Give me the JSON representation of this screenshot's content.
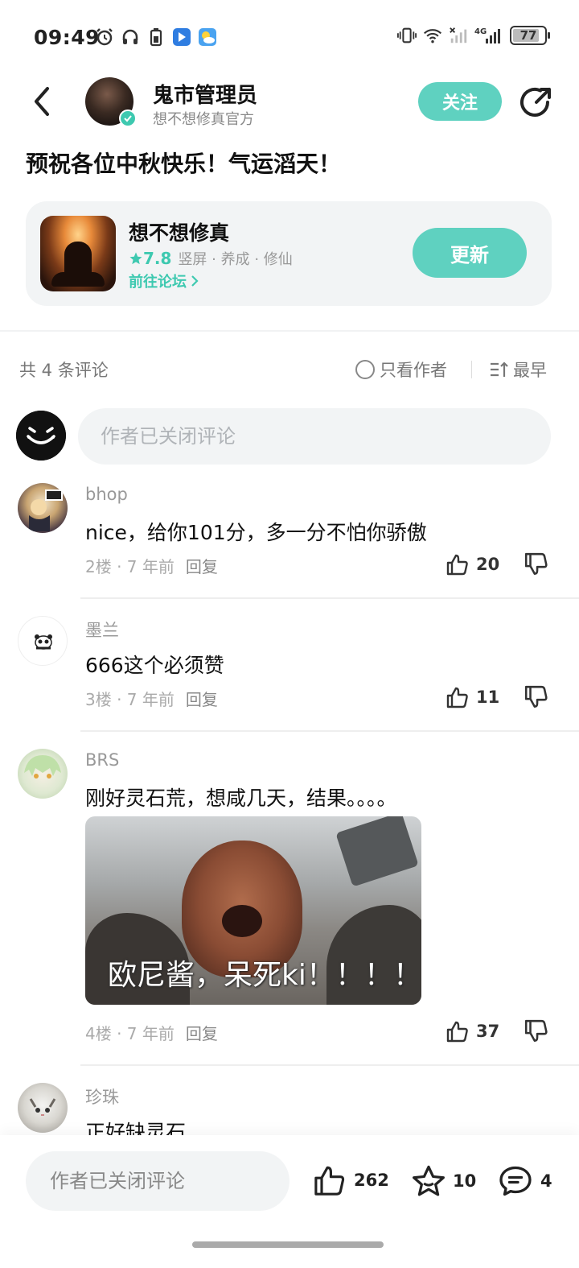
{
  "status_bar": {
    "time": "09:49",
    "battery": "77",
    "battery_level": 0.77,
    "network": "4G"
  },
  "header": {
    "author_name": "鬼市管理员",
    "author_subtitle": "想不想修真官方",
    "follow_label": "关注"
  },
  "post": {
    "title": "预祝各位中秋快乐！气运滔天！"
  },
  "game_card": {
    "name": "想不想修真",
    "rating": "7.8",
    "tags": "竖屏 · 养成 · 修仙",
    "forum_link": "前往论坛",
    "update_label": "更新"
  },
  "comments_header": {
    "count_text": "共 4 条评论",
    "only_author": "只看作者",
    "sort": "最早"
  },
  "comment_input": {
    "placeholder": "作者已关闭评论"
  },
  "comments": [
    {
      "user": "bhop",
      "text": "nice，给你101分，多一分不怕你骄傲",
      "floor": "2楼 · 7 年前",
      "reply": "回复",
      "likes": "20"
    },
    {
      "user": "墨兰",
      "text": "666这个必须赞",
      "floor": "3楼 · 7 年前",
      "reply": "回复",
      "likes": "11"
    },
    {
      "user": "BRS",
      "text": "刚好灵石荒，想咸几天，结果。。。。",
      "image_caption": "欧尼酱，呆死ki！！！！",
      "floor": "4楼 · 7 年前",
      "reply": "回复",
      "likes": "37"
    },
    {
      "user": "珍珠",
      "text": "正好缺灵石"
    }
  ],
  "bottom_bar": {
    "placeholder": "作者已关闭评论",
    "likes": "262",
    "favorites": "10",
    "comments": "4"
  },
  "colors": {
    "accent": "#5fd1c0",
    "accent_text": "#3ec9b0"
  }
}
